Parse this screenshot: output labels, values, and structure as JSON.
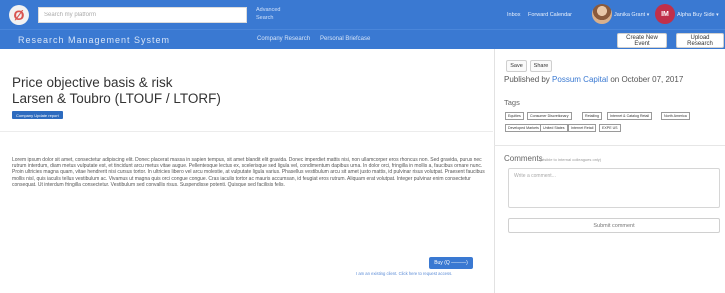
{
  "header": {
    "logo_glyph": "Ø",
    "search_placeholder": "Search my platform",
    "advanced_search": "Advanced Search",
    "links": {
      "inbox": "Inbox",
      "calendar": "Forward Calendar"
    },
    "user1": {
      "name": "Janika Grant"
    },
    "user2": {
      "initials": "IM",
      "name": "Alpha Buy Side"
    },
    "caret": "▾"
  },
  "subheader": {
    "app_title": "Research Management System",
    "nav": {
      "company_research": "Company Research",
      "personal_briefcase": "Personal Briefcase"
    },
    "create_event": "Create New Event",
    "upload_research": "Upload Research"
  },
  "document": {
    "title": "Price objective basis & risk",
    "subtitle": "Larsen & Toubro (LTOUF / LTORF)",
    "tag": "Company Update report",
    "body": "Lorem ipsum dolor sit amet, consectetur adipiscing elit. Donec placerat massa in sapien tempus, sit amet blandit elit gravida. Donec imperdiet mattis nisi, non ullamcorper eros rhoncus non. Sed gravida, purus nec rutrum interdum, diam metus vulputate est, et tincidunt arcu metus vitae augue. Pellentesque lectus ex, scelerisque sed ligula vel, condimentum dapibus urna. In dolor orci, fringilla in mollis a, faucibus ornare nunc. Proin ultricies magna quam, vitae hendrerit nisi cursus tortor. In ultricies libero vel arcu molestie, at vulputate ligula varius. Phasellus vestibulum arcu sit amet justo mattis, id pulvinar risus volutpat. Praesent faucibus mollis nisl, quis iaculis tellus vestibulum ac. Vivamus ut magna quis orci congue congue. Cras iaculis tortor ac mauris accumsan, id feugiat eros rutrum. Aliquam erat volutpat. Integer pulvinar enim consectetur consequat. Ut interdum fringilla consectetur. Vestibulum sed convallis risus. Suspendisse potenti. Quisque sed facilisis felis.",
    "action_button": "Buy (Q ———)",
    "access_note": "I am an existing client. Click here to request access."
  },
  "sidebar": {
    "save": "Save",
    "share": "Share",
    "published_prefix": "Published by",
    "publisher": "Possum Capital",
    "published_on": "on",
    "published_date": "October 07, 2017",
    "tags_label": "Tags",
    "tags": [
      "Equities",
      "Consumer Discretionary",
      "Retailing",
      "Internet & Catalog Retail",
      "North America",
      "Developed Markets",
      "United States",
      "Internet Retail",
      "EXPE US"
    ],
    "comments_title": "Comments",
    "comments_note": "(visible to internal colleagues only)",
    "comment_placeholder": "Write a comment...",
    "submit": "Submit comment"
  }
}
